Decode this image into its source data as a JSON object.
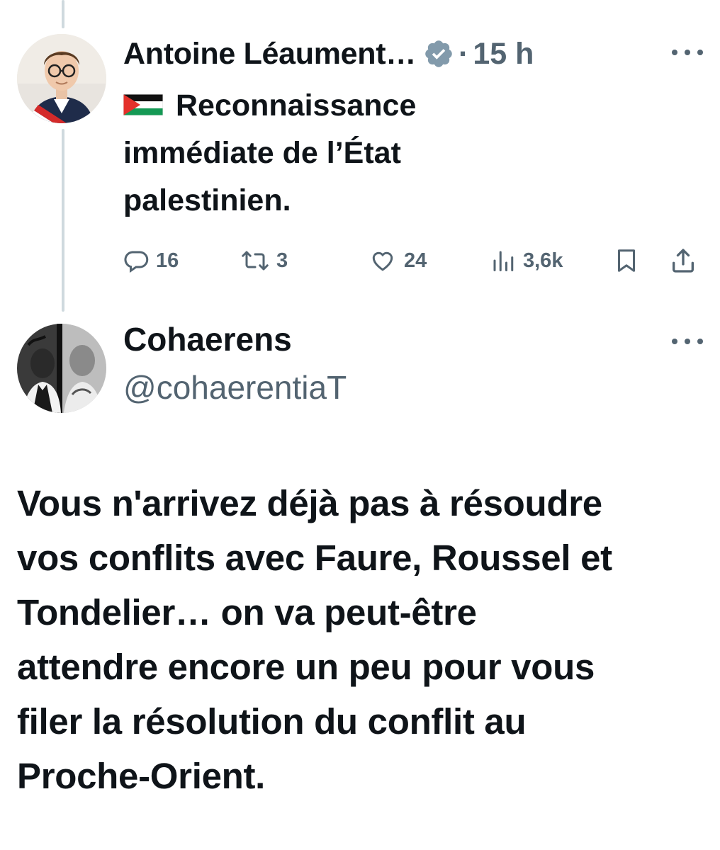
{
  "tweet1": {
    "author_name": "Antoine Léaument…",
    "separator": "·",
    "time": "15 h",
    "flag_emoji_name": "palestine-flag",
    "text": "Reconnaissance immédiate de l’État palestinien.",
    "text_lines": [
      "Reconnaissance",
      "immédiate de l’État",
      "palestinien."
    ],
    "stats": {
      "replies": "16",
      "reposts": "3",
      "likes": "24",
      "views": "3,6k"
    }
  },
  "tweet2": {
    "author_name": "Cohaerens",
    "handle": "@cohaerentiaT",
    "text_lines": [
      "Vous n'arrivez déjà pas à résoudre",
      "vos conflits avec Faure, Roussel et",
      "Tondelier… on va peut-être",
      "attendre encore un peu pour vous",
      "filer la résolution du conflit au",
      "Proche-Orient."
    ]
  },
  "colors": {
    "text": "#0f1419",
    "secondary": "#536471",
    "verified_badge": "#829aab",
    "thread_line": "#cfd9de"
  },
  "icons": [
    "verified-badge-icon",
    "more-icon",
    "reply-icon",
    "retweet-icon",
    "heart-icon",
    "views-icon",
    "bookmark-icon",
    "share-icon"
  ]
}
